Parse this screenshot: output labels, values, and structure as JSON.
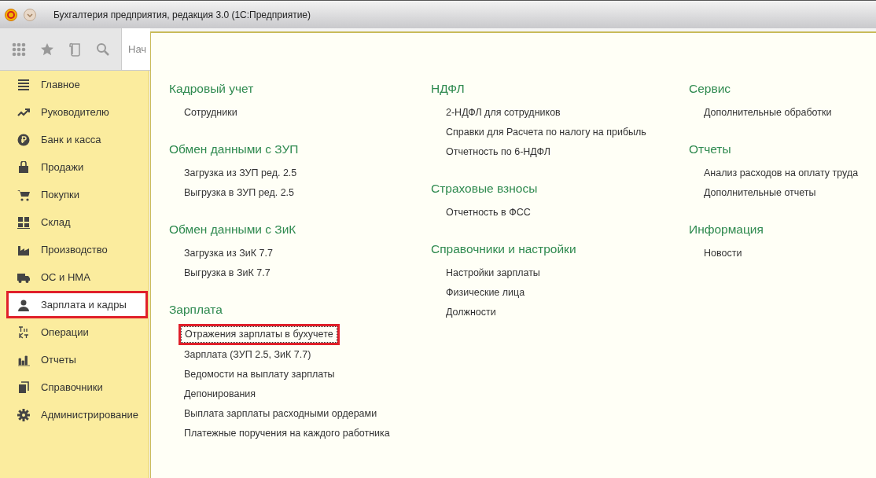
{
  "window": {
    "title": "Бухгалтерия предприятия, редакция 3.0  (1С:Предприятие)"
  },
  "tab": {
    "label": "Нач"
  },
  "sidebar": {
    "items": [
      {
        "label": "Главное",
        "selected": false
      },
      {
        "label": "Руководителю",
        "selected": false
      },
      {
        "label": "Банк и касса",
        "selected": false
      },
      {
        "label": "Продажи",
        "selected": false
      },
      {
        "label": "Покупки",
        "selected": false
      },
      {
        "label": "Склад",
        "selected": false
      },
      {
        "label": "Производство",
        "selected": false
      },
      {
        "label": "ОС и НМА",
        "selected": false
      },
      {
        "label": "Зарплата и кадры",
        "selected": true
      },
      {
        "label": "Операции",
        "selected": false
      },
      {
        "label": "Отчеты",
        "selected": false
      },
      {
        "label": "Справочники",
        "selected": false
      },
      {
        "label": "Администрирование",
        "selected": false
      }
    ]
  },
  "panel": {
    "columns": [
      [
        {
          "heading": "Кадровый учет",
          "links": [
            {
              "label": "Сотрудники",
              "highlighted": false
            }
          ]
        },
        {
          "heading": "Обмен данными с ЗУП",
          "links": [
            {
              "label": "Загрузка из ЗУП ред. 2.5",
              "highlighted": false
            },
            {
              "label": "Выгрузка в ЗУП ред. 2.5",
              "highlighted": false
            }
          ]
        },
        {
          "heading": "Обмен данными с ЗиК",
          "links": [
            {
              "label": "Загрузка из ЗиК 7.7",
              "highlighted": false
            },
            {
              "label": "Выгрузка в ЗиК 7.7",
              "highlighted": false
            }
          ]
        },
        {
          "heading": "Зарплата",
          "links": [
            {
              "label": "Отражения зарплаты в бухучете",
              "highlighted": true
            },
            {
              "label": "Зарплата (ЗУП 2.5, ЗиК 7.7)",
              "highlighted": false
            },
            {
              "label": "Ведомости на выплату зарплаты",
              "highlighted": false
            },
            {
              "label": "Депонирования",
              "highlighted": false
            },
            {
              "label": "Выплата зарплаты расходными ордерами",
              "highlighted": false
            },
            {
              "label": "Платежные поручения на каждого работника",
              "highlighted": false
            }
          ]
        }
      ],
      [
        {
          "heading": "НДФЛ",
          "links": [
            {
              "label": "2-НДФЛ для сотрудников",
              "highlighted": false
            },
            {
              "label": "Справки для Расчета по налогу на прибыль",
              "highlighted": false
            },
            {
              "label": "Отчетность по 6-НДФЛ",
              "highlighted": false
            }
          ]
        },
        {
          "heading": "Страховые взносы",
          "links": [
            {
              "label": "Отчетность в ФСС",
              "highlighted": false
            }
          ]
        },
        {
          "heading": "Справочники и настройки",
          "links": [
            {
              "label": "Настройки зарплаты",
              "highlighted": false
            },
            {
              "label": "Физические лица",
              "highlighted": false
            },
            {
              "label": "Должности",
              "highlighted": false
            }
          ]
        }
      ],
      [
        {
          "heading": "Сервис",
          "links": [
            {
              "label": "Дополнительные обработки",
              "highlighted": false
            }
          ]
        },
        {
          "heading": "Отчеты",
          "links": [
            {
              "label": "Анализ расходов на оплату труда",
              "highlighted": false
            },
            {
              "label": "Дополнительные отчеты",
              "highlighted": false
            }
          ]
        },
        {
          "heading": "Информация",
          "links": [
            {
              "label": "Новости",
              "highlighted": false
            }
          ]
        }
      ]
    ]
  }
}
